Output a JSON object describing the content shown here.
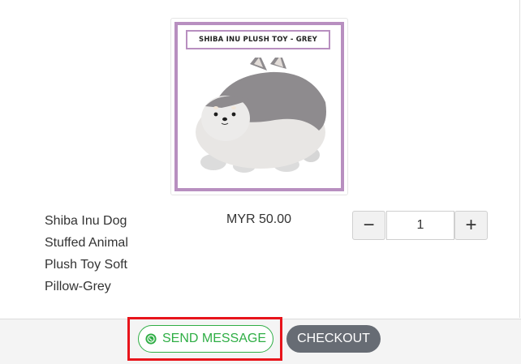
{
  "product": {
    "image_banner": "SHIBA INU PLUSH TOY - GREY",
    "name": "Shiba Inu Dog Stuffed Animal Plush Toy Soft Pillow-Grey",
    "price": "MYR 50.00",
    "quantity": "1",
    "minus_label": "−",
    "plus_label": "+"
  },
  "footer": {
    "send_message_label": "SEND MESSAGE",
    "send_message_icon": "whatsapp-icon",
    "checkout_label": "CHECKOUT"
  },
  "colors": {
    "send_message_green": "#2fae45",
    "checkout_gray": "#676c74",
    "highlight_red": "#e8141b",
    "image_frame_purple": "#b88fc0"
  }
}
